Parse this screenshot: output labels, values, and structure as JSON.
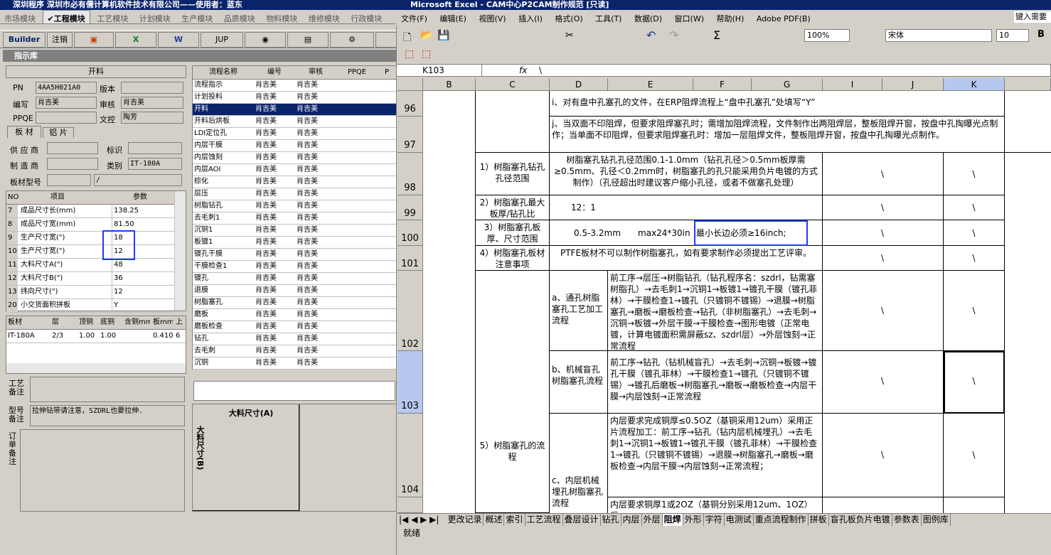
{
  "left_app": {
    "title": "深圳程序    深圳市必有儒计算机软件技术有限公司——使用者：蓝东",
    "modules": [
      "市场模块",
      "工程模块",
      "工艺模块",
      "计划模块",
      "生产模块",
      "品质模块",
      "物料模块",
      "维修模块",
      "行政模块"
    ],
    "active_module": "工程模块",
    "toolbar": {
      "builder": "Builder",
      "logout": "注销",
      "jup": "JUP"
    },
    "panel_title": "指示库",
    "section": "开料",
    "pn_label": "PN",
    "pn_value": "4AA5H021A0",
    "version_label": "版本",
    "version_value": "",
    "editor_label": "编写",
    "editor_value": "肖吉美",
    "reviewer_label": "审核",
    "reviewer_value": "肖吉美",
    "ppqe_label": "PPQE",
    "ppqe_value": "",
    "writer_label": "文控",
    "writer_value": "陶芳",
    "tabs": [
      "板 材",
      "铝 片"
    ],
    "supplier_label": "供 应 商",
    "mark_label": "标识",
    "manufacturer_label": "制 造 商",
    "category_label": "类别",
    "category_value": "IT-180A",
    "model_label": "板材型号",
    "model_value": "/",
    "param_headers": [
      "NO",
      "项目",
      "参数"
    ],
    "params": [
      {
        "no": "7",
        "item": "成品尺寸长(mm)",
        "val": "138.25"
      },
      {
        "no": "8",
        "item": "成品尺寸宽(mm)",
        "val": "81.50"
      },
      {
        "no": "9",
        "item": "生产尺寸宽(\")",
        "val": "18"
      },
      {
        "no": "10",
        "item": "生产尺寸宽(\")",
        "val": "12"
      },
      {
        "no": "11",
        "item": "大料尺寸A(\")",
        "val": "48"
      },
      {
        "no": "12",
        "item": "大料尺寸B(\")",
        "val": "36"
      },
      {
        "no": "13",
        "item": "纬向尺寸(\")",
        "val": "12"
      },
      {
        "no": "20",
        "item": "小交货面积拼板",
        "val": "Y"
      }
    ],
    "board_headers": [
      "板材",
      "层",
      "顶铜",
      "底铜",
      "含铜mm",
      "板mm",
      "上"
    ],
    "board_row": [
      "IT-180A",
      "2/3",
      "1.00",
      "1.00",
      "",
      "0.410",
      "6"
    ],
    "craft_note_label": "工艺备注",
    "model_note_label": "型号备注",
    "model_note_value": "拉伸钻带请注意，SZDRL也要拉伸.",
    "order_note_label": "订单备注",
    "flow_headers": [
      "流程名称",
      "编号",
      "审核",
      "PPQE",
      "P"
    ],
    "flows": [
      {
        "n": "流程指示",
        "a": "肖吉美",
        "b": "肖吉美"
      },
      {
        "n": "计划投料",
        "a": "肖吉美",
        "b": "肖吉美"
      },
      {
        "n": "开料",
        "a": "肖吉美",
        "b": "肖吉美"
      },
      {
        "n": "开料后烘板",
        "a": "肖吉美",
        "b": "肖吉美"
      },
      {
        "n": "LDI定位孔",
        "a": "肖吉美",
        "b": "肖吉美"
      },
      {
        "n": "内层干膜",
        "a": "肖吉美",
        "b": "肖吉美"
      },
      {
        "n": "内层蚀刻",
        "a": "肖吉美",
        "b": "肖吉美"
      },
      {
        "n": "内层AOI",
        "a": "肖吉美",
        "b": "肖吉美"
      },
      {
        "n": "棕化",
        "a": "肖吉美",
        "b": "肖吉美"
      },
      {
        "n": "层压",
        "a": "肖吉美",
        "b": "肖吉美"
      },
      {
        "n": "树脂钻孔",
        "a": "肖吉美",
        "b": "肖吉美"
      },
      {
        "n": "去毛刺1",
        "a": "肖吉美",
        "b": "肖吉美"
      },
      {
        "n": "沉铜1",
        "a": "肖吉美",
        "b": "肖吉美"
      },
      {
        "n": "板镀1",
        "a": "肖吉美",
        "b": "肖吉美"
      },
      {
        "n": "镀孔干膜",
        "a": "肖吉美",
        "b": "肖吉美"
      },
      {
        "n": "干膜检查1",
        "a": "肖吉美",
        "b": "肖吉美"
      },
      {
        "n": "镀孔",
        "a": "肖吉美",
        "b": "肖吉美"
      },
      {
        "n": "退膜",
        "a": "肖吉美",
        "b": "肖吉美"
      },
      {
        "n": "树脂塞孔",
        "a": "肖吉美",
        "b": "肖吉美"
      },
      {
        "n": "磨板",
        "a": "肖吉美",
        "b": "肖吉美"
      },
      {
        "n": "磨板检查",
        "a": "肖吉美",
        "b": "肖吉美"
      },
      {
        "n": "钻孔",
        "a": "肖吉美",
        "b": "肖吉美"
      },
      {
        "n": "去毛刺",
        "a": "肖吉美",
        "b": "肖吉美"
      },
      {
        "n": "沉铜",
        "a": "肖吉美",
        "b": "肖吉美"
      }
    ],
    "selected_flow_index": 2,
    "diagram_a": "大料尺寸(A)",
    "diagram_b": "大料尺寸(B)"
  },
  "excel": {
    "title": "Microsoft Excel - CAM中心P2CAM制作规范 [只读]",
    "menus": [
      "文件(F)",
      "编辑(E)",
      "视图(V)",
      "插入(I)",
      "格式(O)",
      "工具(T)",
      "数据(D)",
      "窗口(W)",
      "帮助(H)",
      "Adobe PDF(B)"
    ],
    "help_box": "键入需要",
    "zoom": "100%",
    "font": "宋体",
    "font_size": "10",
    "name_box": "K103",
    "fx": "fx",
    "formula": "\\",
    "columns": [
      "B",
      "C",
      "D",
      "E",
      "F",
      "G",
      "I",
      "J",
      "K"
    ],
    "rows": [
      "96",
      "97",
      "98",
      "99",
      "100",
      "101",
      "102",
      "103",
      "104"
    ],
    "r96": "i、对有盘中孔塞孔的文件，在ERP阻焊流程上“盘中孔塞孔”处填写“Y”",
    "r97": "j、当双面不印阻焊，但要求阻焊塞孔时；需增加阻焊流程，文件制作出两阻焊层，整板阻焊开窗，按盘中孔掏曝光点制作；当单面不印阻焊，但要求阻焊塞孔时：增加一层阻焊文件，整板阻焊开窗，按盘中孔掏曝光点制作。",
    "r98c": "1）树脂塞孔钻孔孔径范围",
    "r98d": "树脂塞孔钻孔孔径范围0.1-1.0mm（钻孔孔径＞0.5mm板厚需≥0.5mm、孔径＜0.2mm时，树脂塞孔的孔只能采用负片电镀的方式制作）（孔径超出时建议客户缩小孔径，或者不做塞孔处理）",
    "r99c": "2）树脂塞孔最大板厚/钻孔比",
    "r99d": "12：1",
    "r100c": "3）树脂塞孔板厚、尺寸范围",
    "r100d": "0.5-3.2mm",
    "r100e": "max24*30in",
    "r100f": "最小长边必须≥16inch;",
    "r101c": "4）树脂塞孔板材注意事项",
    "r101d": "PTFE板材不可以制作树脂塞孔，如有要求制作必须提出工艺评审。",
    "r105c": "5）树脂塞孔的流程",
    "r102d": "a、通孔树脂塞孔工艺加工流程",
    "r102e": "前工序→层压→树脂钻孔（钻孔程序名：szdrl，钻需塞树脂孔）→去毛刺1→沉铜1→板镀1→镀孔干膜（镀孔菲林）→干膜检查1→镀孔（只镀铜不镀锡）→退膜→树脂塞孔→磨板→磨板检查→钻孔（非树脂塞孔）→去毛刺→沉铜→板镀→外层干膜→干膜检查→图形电镀（正常电镀，计算电镀面积需屏蔽sz、szdrl层）→外层蚀刻→正常流程",
    "r103d": "b、机械盲孔树脂塞孔流程",
    "r103e": "前工序→钻孔（钻机械盲孔）→去毛刺→沉铜→板镀→镀孔干膜（镀孔菲林）→干膜检查1→镀孔（只镀铜不镀锡）→镀孔后磨板→树脂塞孔→磨板→磨板检查→内层干膜→内层蚀刻→正常流程",
    "r104d": "c、内层机械埋孔树脂塞孔流程",
    "r104e": "内层要求完成铜厚≤0.5OZ（基铜采用12um）采用正片流程加工：前工序→钻孔（钻内层机械埋孔）→去毛刺1→沉铜1→板镀1→镀孔干膜（镀孔菲林）→干膜检查1→镀孔（只镀铜不镀锡）→退膜→树脂塞孔→磨板→磨板检查→内层干膜→内层蚀刻→正常流程；",
    "r104e2": "内层要求铜厚1或2OZ（基铜分别采用12um、1OZ）采",
    "backslash": "\\",
    "sheet_tabs": [
      "更改记录",
      "概述",
      "索引",
      "工艺流程",
      "叠层设计",
      "钻孔",
      "内层",
      "外层",
      "阻焊",
      "外形",
      "字符",
      "电测试",
      "重点流程制作",
      "拼板",
      "盲孔板负片电镀",
      "参数表",
      "图例库"
    ],
    "active_sheet": "阻焊",
    "status": "就绪"
  }
}
